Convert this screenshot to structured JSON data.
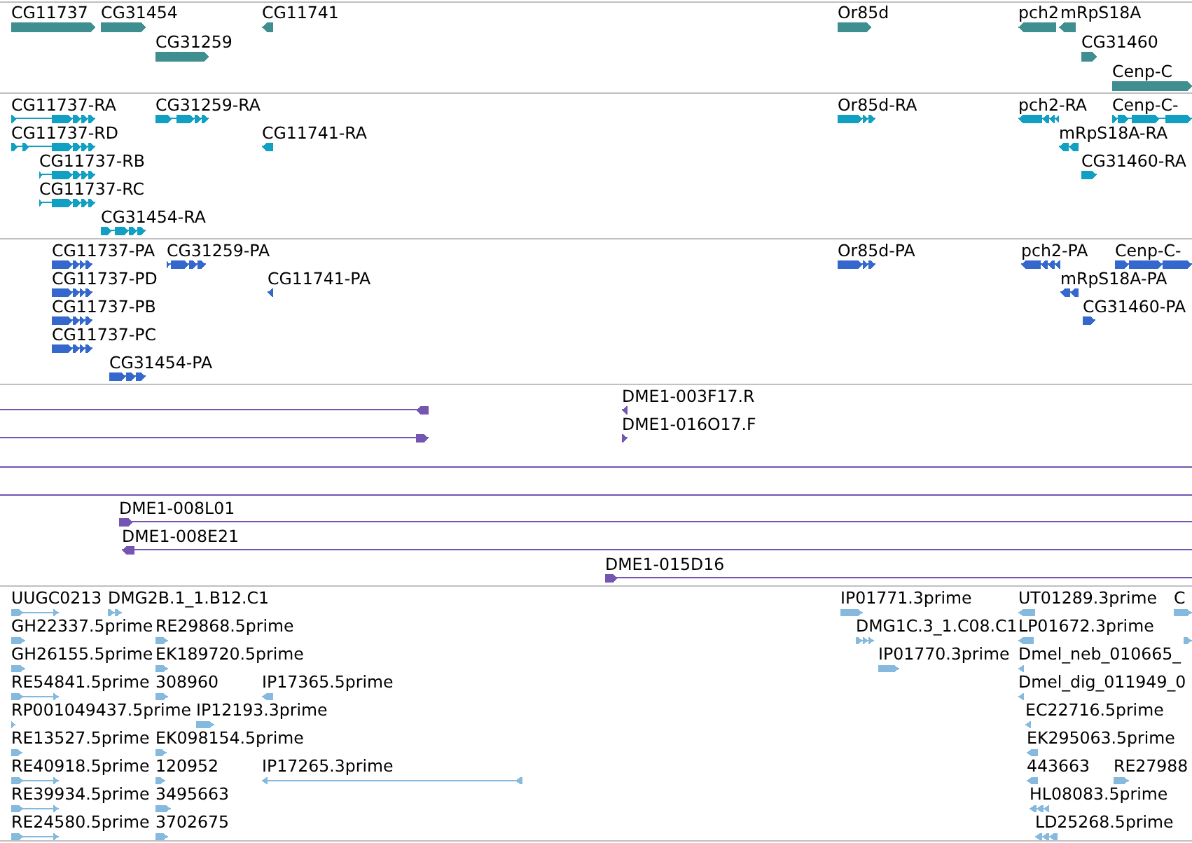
{
  "tracks": [
    {
      "kind": "gene",
      "features": [
        {
          "label": "CG11737",
          "reverse": false
        },
        {
          "label": "CG31454",
          "reverse": false
        },
        {
          "label": "CG11741",
          "reverse": true
        },
        {
          "label": "Or85d",
          "reverse": false
        },
        {
          "label": "pch2",
          "reverse": true
        },
        {
          "label": "mRpS18A",
          "reverse": true
        },
        {
          "label": "CG31259",
          "reverse": false
        },
        {
          "label": "CG31460",
          "reverse": false
        },
        {
          "label": "Cenp-C",
          "reverse": false
        }
      ]
    },
    {
      "kind": "transcript",
      "features": [
        {
          "label": "CG11737-RA",
          "reverse": false
        },
        {
          "label": "CG31259-RA",
          "reverse": false
        },
        {
          "label": "Or85d-RA",
          "reverse": false
        },
        {
          "label": "pch2-RA",
          "reverse": true
        },
        {
          "label": "Cenp-C-",
          "reverse": false
        },
        {
          "label": "CG11737-RD",
          "reverse": false
        },
        {
          "label": "CG11741-RA",
          "reverse": true
        },
        {
          "label": "mRpS18A-RA",
          "reverse": true
        },
        {
          "label": "CG11737-RB",
          "reverse": false
        },
        {
          "label": "CG31460-RA",
          "reverse": false
        },
        {
          "label": "CG11737-RC",
          "reverse": false
        },
        {
          "label": "CG31454-RA",
          "reverse": false
        }
      ]
    },
    {
      "kind": "protein",
      "features": [
        {
          "label": "CG11737-PA",
          "reverse": false
        },
        {
          "label": "CG31259-PA",
          "reverse": false
        },
        {
          "label": "Or85d-PA",
          "reverse": false
        },
        {
          "label": "pch2-PA",
          "reverse": true
        },
        {
          "label": "Cenp-C-",
          "reverse": false
        },
        {
          "label": "CG11737-PD",
          "reverse": false
        },
        {
          "label": "CG11741-PA",
          "reverse": true
        },
        {
          "label": "mRpS18A-PA",
          "reverse": true
        },
        {
          "label": "CG11737-PB",
          "reverse": false
        },
        {
          "label": "CG31460-PA",
          "reverse": false
        },
        {
          "label": "CG11737-PC",
          "reverse": false
        },
        {
          "label": "CG31454-PA",
          "reverse": false
        }
      ]
    },
    {
      "kind": "clone",
      "features": [
        {
          "kind": "clone",
          "reverse": true
        },
        {
          "kind": "clone",
          "label": "DME1-003F17.R",
          "reverse": true
        },
        {
          "kind": "clone",
          "reverse": false
        },
        {
          "kind": "clone",
          "label": "DME1-016O17.F",
          "reverse": false
        },
        {
          "kind": "span"
        },
        {
          "kind": "span"
        },
        {
          "kind": "clone",
          "label": "DME1-008L01",
          "reverse": false
        },
        {
          "kind": "clone",
          "label": "DME1-008E21",
          "reverse": true
        },
        {
          "kind": "clone",
          "label": "DME1-015D16",
          "reverse": false
        }
      ]
    },
    {
      "kind": "est",
      "features": [
        {
          "label": "UUGC0213",
          "reverse": false
        },
        {
          "label": "DMG2B.1_1.B12.C1",
          "reverse": false
        },
        {
          "label": "IP01771.3prime",
          "reverse": false
        },
        {
          "label": "UT01289.3prime",
          "reverse": true
        },
        {
          "label": "C",
          "reverse": false
        },
        {
          "label": "GH22337.5prime",
          "reverse": false
        },
        {
          "label": "RE29868.5prime",
          "reverse": false
        },
        {
          "label": "DMG1C.3_1.C08.C1",
          "reverse": false
        },
        {
          "label": "LP01672.3prime",
          "reverse": true
        },
        {
          "reverse": false
        },
        {
          "label": "GH26155.5prime",
          "reverse": false
        },
        {
          "label": "EK189720.5prime",
          "reverse": false
        },
        {
          "label": "IP01770.3prime",
          "reverse": false
        },
        {
          "label": "Dmel_neb_010665_",
          "reverse": true
        },
        {
          "label": "RE54841.5prime",
          "reverse": false
        },
        {
          "label": "308960",
          "reverse": false
        },
        {
          "label": "IP17365.5prime",
          "reverse": true
        },
        {
          "label": "Dmel_dig_011949_0",
          "reverse": true
        },
        {
          "label": "RP001049437.5prime",
          "reverse": false
        },
        {
          "label": "IP12193.3prime",
          "reverse": false
        },
        {
          "label": "EC22716.5prime",
          "reverse": true
        },
        {
          "label": "RE13527.5prime",
          "reverse": false
        },
        {
          "label": "EK098154.5prime",
          "reverse": false
        },
        {
          "label": "EK295063.5prime",
          "reverse": true
        },
        {
          "label": "RE40918.5prime",
          "reverse": false
        },
        {
          "label": "120952",
          "reverse": false
        },
        {
          "label": "IP17265.3prime",
          "reverse": true
        },
        {
          "label": "443663",
          "reverse": true
        },
        {
          "label": "RE27988",
          "reverse": false
        },
        {
          "label": "RE39934.5prime",
          "reverse": false
        },
        {
          "label": "3495663",
          "reverse": false
        },
        {
          "label": "HL08083.5prime",
          "reverse": true
        },
        {
          "label": "RE24580.5prime",
          "reverse": false
        },
        {
          "label": "3702675",
          "reverse": false
        },
        {
          "label": "LD25268.5prime",
          "reverse": true
        }
      ]
    }
  ]
}
